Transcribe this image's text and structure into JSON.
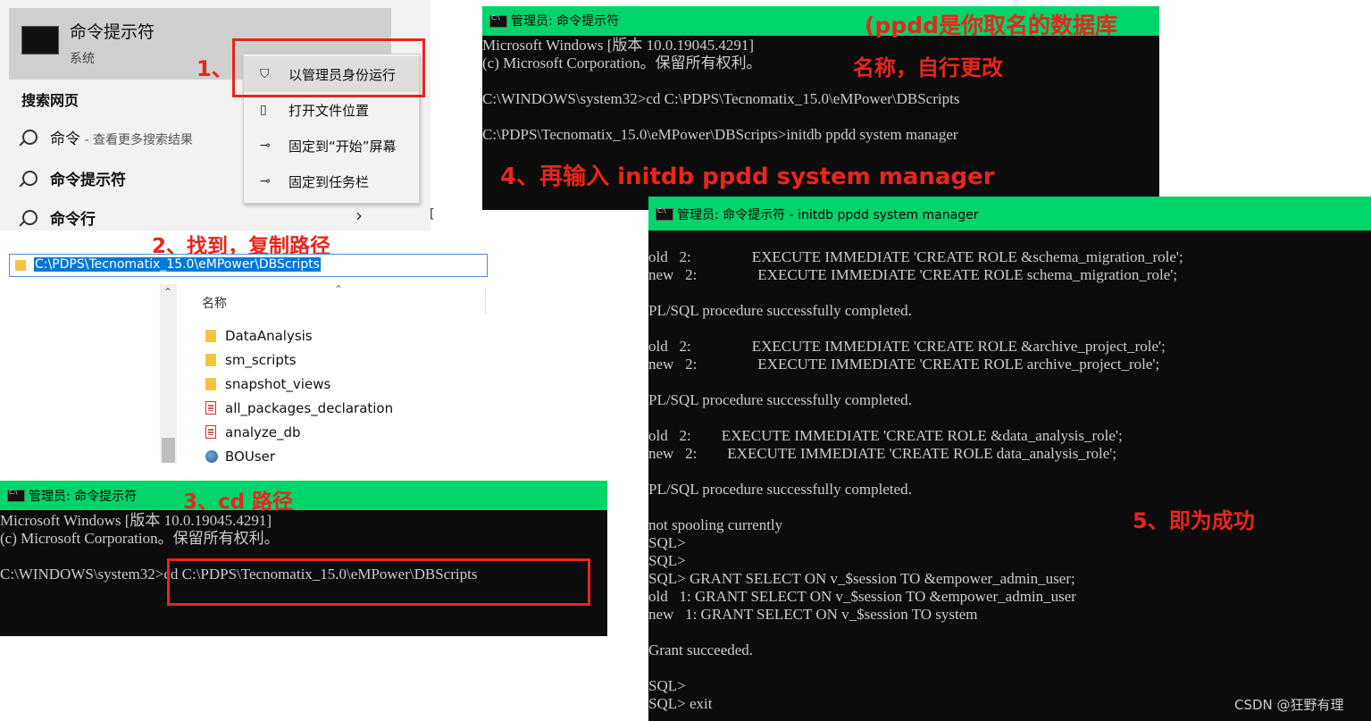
{
  "start_menu": {
    "best_match_title": "命令提示符",
    "best_match_subtitle": "系统",
    "search_web_header": "搜索网页",
    "search_results": [
      {
        "label": "命令",
        "suffix": " - 查看更多搜索结果"
      },
      {
        "label": "命令提示符",
        "suffix": ""
      },
      {
        "label": "命令行",
        "suffix": ""
      }
    ],
    "context_menu": [
      "以管理员身份运行",
      "打开文件位置",
      "固定到“开始”屏幕",
      "固定到任务栏"
    ]
  },
  "explorer": {
    "address": "C:\\PDPS\\Tecnomatix_15.0\\eMPower\\DBScripts",
    "column_header": "名称",
    "files": [
      {
        "name": "DataAnalysis",
        "kind": "folder"
      },
      {
        "name": "sm_scripts",
        "kind": "folder"
      },
      {
        "name": "snapshot_views",
        "kind": "folder"
      },
      {
        "name": "all_packages_declaration",
        "kind": "sql"
      },
      {
        "name": "analyze_db",
        "kind": "sql"
      },
      {
        "name": "BOUser",
        "kind": "app"
      }
    ]
  },
  "cmd_small": {
    "title": "管理员: 命令提示符",
    "lines": [
      "Microsoft Windows [版本 10.0.19045.4291]",
      "(c) Microsoft Corporation。保留所有权利。",
      "",
      "C:\\WINDOWS\\system32>cd C:\\PDPS\\Tecnomatix_15.0\\eMPower\\DBScripts"
    ]
  },
  "cmd_top": {
    "title": "管理员: 命令提示符",
    "lines": [
      "Microsoft Windows [版本 10.0.19045.4291]",
      "(c) Microsoft Corporation。保留所有权利。",
      "",
      "C:\\WINDOWS\\system32>cd C:\\PDPS\\Tecnomatix_15.0\\eMPower\\DBScripts",
      "",
      "C:\\PDPS\\Tecnomatix_15.0\\eMPower\\DBScripts>initdb ppdd system manager"
    ]
  },
  "cmd_big": {
    "title": "管理员: 命令提示符 - initdb  ppdd system manager",
    "lines": [
      "old   2:                EXECUTE IMMEDIATE 'CREATE ROLE &schema_migration_role';",
      "new   2:                EXECUTE IMMEDIATE 'CREATE ROLE schema_migration_role';",
      "",
      "PL/SQL procedure successfully completed.",
      "",
      "old   2:                EXECUTE IMMEDIATE 'CREATE ROLE &archive_project_role';",
      "new   2:                EXECUTE IMMEDIATE 'CREATE ROLE archive_project_role';",
      "",
      "PL/SQL procedure successfully completed.",
      "",
      "old   2:        EXECUTE IMMEDIATE 'CREATE ROLE &data_analysis_role';",
      "new   2:        EXECUTE IMMEDIATE 'CREATE ROLE data_analysis_role';",
      "",
      "PL/SQL procedure successfully completed.",
      "",
      "not spooling currently",
      "SQL>",
      "SQL>",
      "SQL> GRANT SELECT ON v_$session TO &empower_admin_user;",
      "old   1: GRANT SELECT ON v_$session TO &empower_admin_user",
      "new   1: GRANT SELECT ON v_$session TO system",
      "",
      "Grant succeeded.",
      "",
      "SQL>",
      "SQL> exit"
    ]
  },
  "annotations": {
    "step1": "1、",
    "step2": "2、找到，复制路径",
    "step3": "3、cd 路径",
    "step4": "4、再输入 initdb ppdd system manager",
    "step5": "5、即为成功",
    "note_line1": "(ppdd是你取名的数据库",
    "note_line2": "名称，自行更改"
  },
  "watermark": "CSDN @狂野有理",
  "colors": {
    "title_bar": "#00d56b",
    "annotation_red": "#e8261c",
    "console_bg": "#0c0c0c",
    "console_text": "#cccccc"
  }
}
